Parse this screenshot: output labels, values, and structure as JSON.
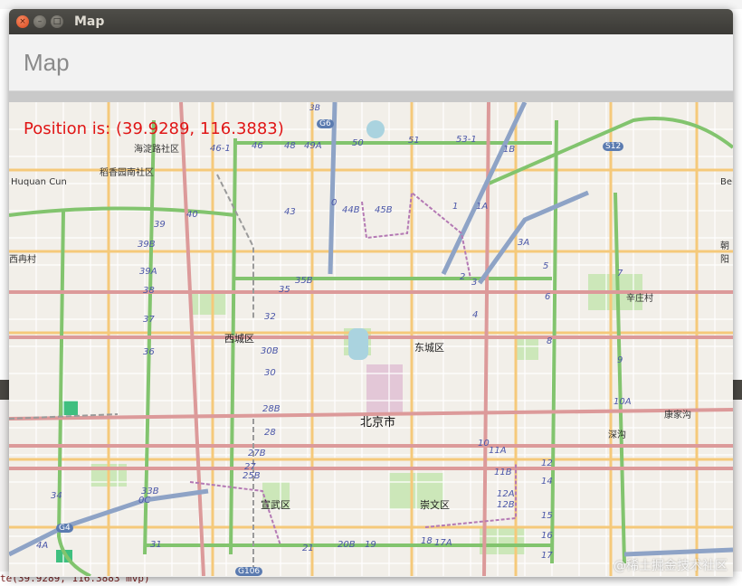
{
  "window": {
    "title": "Map",
    "buttons": {
      "close": "×",
      "minimize": "–",
      "maximize": "□"
    }
  },
  "app": {
    "header_title": "Map"
  },
  "map": {
    "position_text": "Position is: (39.9289, 116.3883)",
    "labels": [
      {
        "text": "海淀路社区"
      },
      {
        "text": "稻香园南社区"
      },
      {
        "text": "Huquan Cun"
      },
      {
        "text": "西城区"
      },
      {
        "text": "东城区"
      },
      {
        "text": "北京市"
      },
      {
        "text": "宣武区"
      },
      {
        "text": "崇文区"
      },
      {
        "text": "辛庄村"
      },
      {
        "text": "康家沟"
      },
      {
        "text": "深沟"
      },
      {
        "text": "朝阳"
      },
      {
        "text": "西冉村"
      },
      {
        "text": "Bei"
      }
    ],
    "road_numbers": [
      "3B",
      "G6",
      "50",
      "51",
      "53-1",
      "1B",
      "S12",
      "49A",
      "48",
      "46",
      "46-1",
      "1",
      "0",
      "44B",
      "45B",
      "43",
      "40",
      "39",
      "39B",
      "39A",
      "38",
      "37",
      "36",
      "35B",
      "35",
      "34",
      "33B",
      "32",
      "30B",
      "30",
      "28B",
      "28",
      "27B",
      "27",
      "25B",
      "2",
      "3",
      "3A",
      "4",
      "5",
      "6",
      "7",
      "8",
      "9",
      "10",
      "10A",
      "11A",
      "11B",
      "12",
      "12A",
      "12B",
      "14",
      "15",
      "16",
      "17",
      "17A",
      "18",
      "19",
      "20B",
      "21",
      "31",
      "4A",
      "G4",
      "0C",
      "G106",
      "1A"
    ],
    "watermark": "@稀土掘金技术社区"
  },
  "background": {
    "terminal_text": "te(39.9289, 116.3883 mvp)"
  }
}
